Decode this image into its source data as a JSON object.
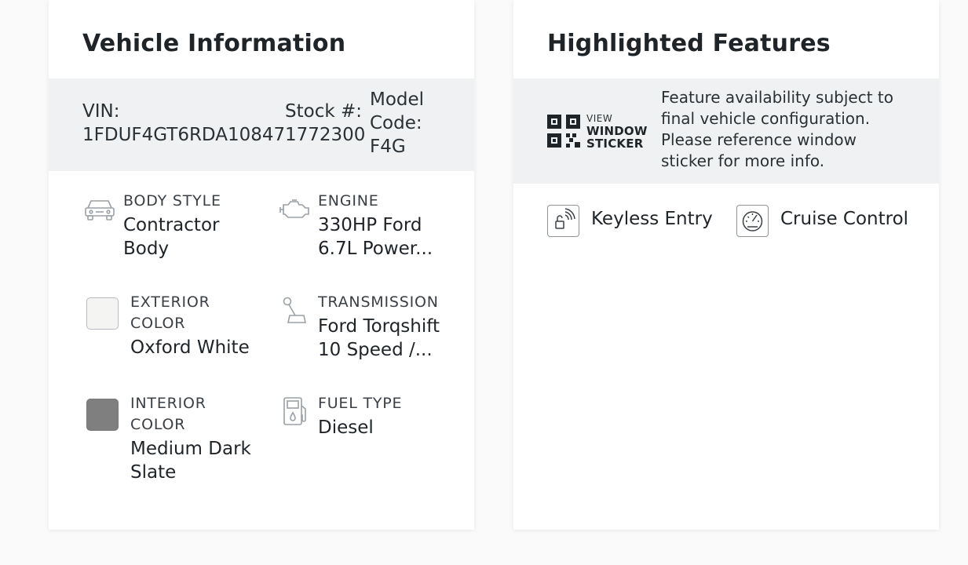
{
  "vehicle_info": {
    "title": "Vehicle Information",
    "vin_label": "VIN:",
    "vin_value": "1FDUF4GT6RDA10847",
    "stock_label": "Stock #:",
    "stock_value": "1772300",
    "model_label_1": "Model",
    "model_label_2": "Code:",
    "model_value": "F4G",
    "specs": {
      "body_style": {
        "label": "BODY STYLE",
        "line1": "Contractor",
        "line2": "Body"
      },
      "engine": {
        "label": "ENGINE",
        "line1": "330HP Ford",
        "line2": "6.7L Power..."
      },
      "exterior_color": {
        "label1": "EXTERIOR",
        "label2": "COLOR",
        "value": "Oxford White",
        "swatch": "#f4f4f2"
      },
      "transmission": {
        "label": "TRANSMISSION",
        "line1": "Ford Torqshift",
        "line2": "10 Speed /..."
      },
      "interior_color": {
        "label1": "INTERIOR",
        "label2": "COLOR",
        "line1": "Medium Dark",
        "line2": "Slate",
        "swatch": "#7f7f7f"
      },
      "fuel_type": {
        "label": "FUEL TYPE",
        "value": "Diesel"
      }
    },
    "icons": {
      "body_style": "car-icon",
      "engine": "engine-icon",
      "transmission": "gear-shift-icon",
      "fuel_type": "fuel-pump-icon"
    }
  },
  "highlighted_features": {
    "title": "Highlighted Features",
    "sticker": {
      "small": "VIEW",
      "line1": "WINDOW",
      "line2": "STICKER",
      "icon": "qr-code-icon"
    },
    "note": "Feature availability subject to final vehicle configuration. Please reference window sticker for more info.",
    "features": [
      {
        "label": "Keyless Entry",
        "icon": "keyless-entry-icon"
      },
      {
        "label": "Cruise Control",
        "icon": "speedometer-icon"
      }
    ]
  },
  "colors": {
    "band": "#eff1f2",
    "text": "#1f2429",
    "card": "#ffffff"
  }
}
